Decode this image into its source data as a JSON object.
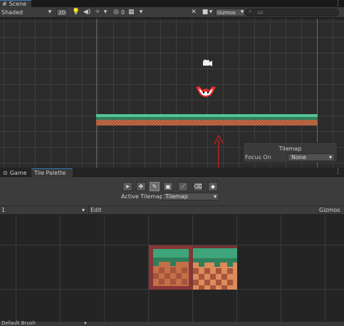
{
  "scene_tab": {
    "label": "Scene",
    "icon": "grid-icon"
  },
  "scene_toolbar": {
    "shading_mode": "Shaded",
    "toggle_2d": "2D",
    "hidden_count": "0",
    "gizmos": "Gizmos",
    "search_placeholder": "All"
  },
  "tilemap_overlay": {
    "title": "Tilemap",
    "focus_label": "Focus On",
    "focus_value": "None"
  },
  "lower_tabs": [
    {
      "label": "Game",
      "icon": "gamepad-icon"
    },
    {
      "label": "Tile Palette",
      "icon": ""
    }
  ],
  "palette": {
    "active_tilemap_label": "Active Tilemap",
    "active_tilemap_value": "Tilemap",
    "palette_name": "1",
    "edit_label": "Edit",
    "gizmos_label": "Gizmos"
  },
  "brush": {
    "name": "Default Brush"
  },
  "colors": {
    "grass": "#3ea57a",
    "dirt": "#c56f48",
    "annotation_red": "#cc2222",
    "selection": "#3a79bb"
  }
}
